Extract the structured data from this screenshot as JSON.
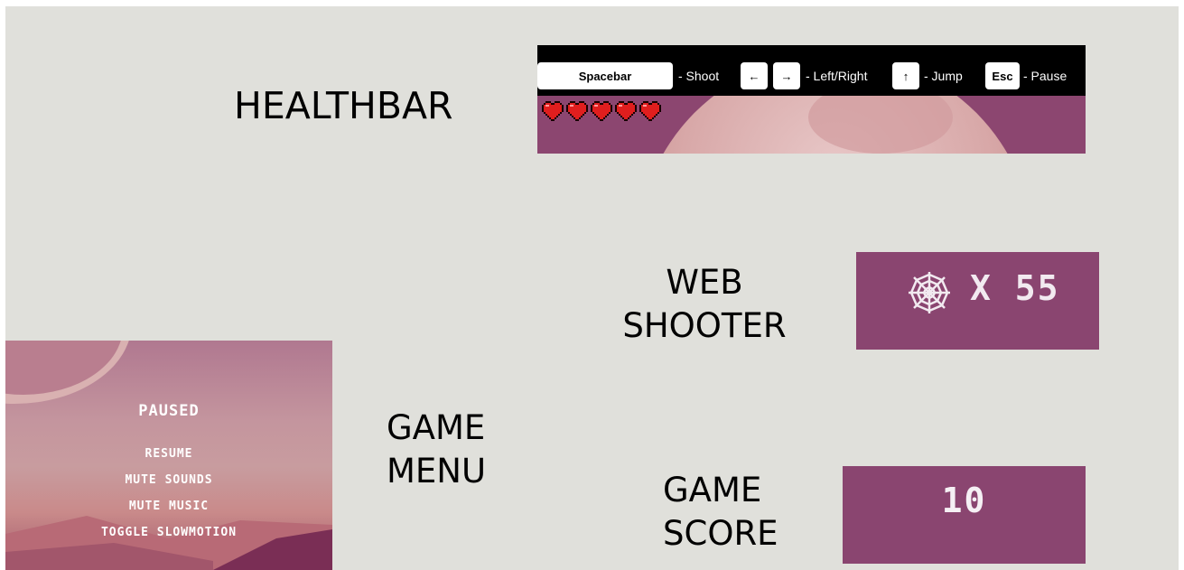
{
  "labels": {
    "healthbar": "HEALTHBAR",
    "web_shooter_line1": "WEB",
    "web_shooter_line2": "SHOOTER",
    "game_menu_line1": "GAME",
    "game_menu_line2": "MENU",
    "game_score_line1": "GAME",
    "game_score_line2": "SCORE"
  },
  "controls": {
    "shoot_key": "Spacebar",
    "shoot_label": "- Shoot",
    "left_key": "←",
    "right_key": "→",
    "move_label": "- Left/Right",
    "jump_key": "↑",
    "jump_label": "- Jump",
    "pause_key": "Esc",
    "pause_label": "- Pause"
  },
  "health": {
    "hearts": 5,
    "max_hearts": 5,
    "heart_color": "#e01e1e",
    "heart_icon": "heart-icon"
  },
  "web_shooter": {
    "icon": "spider-web-icon",
    "count_text": "X 55"
  },
  "score": {
    "value": "10"
  },
  "pause_menu": {
    "title": "PAUSED",
    "items": [
      "RESUME",
      "MUTE SOUNDS",
      "MUTE MUSIC",
      "TOGGLE SLOWMOTION"
    ]
  },
  "colors": {
    "slide_bg": "#e0e0db",
    "panel_purple": "#8a4570",
    "topbar_black": "#000000"
  }
}
